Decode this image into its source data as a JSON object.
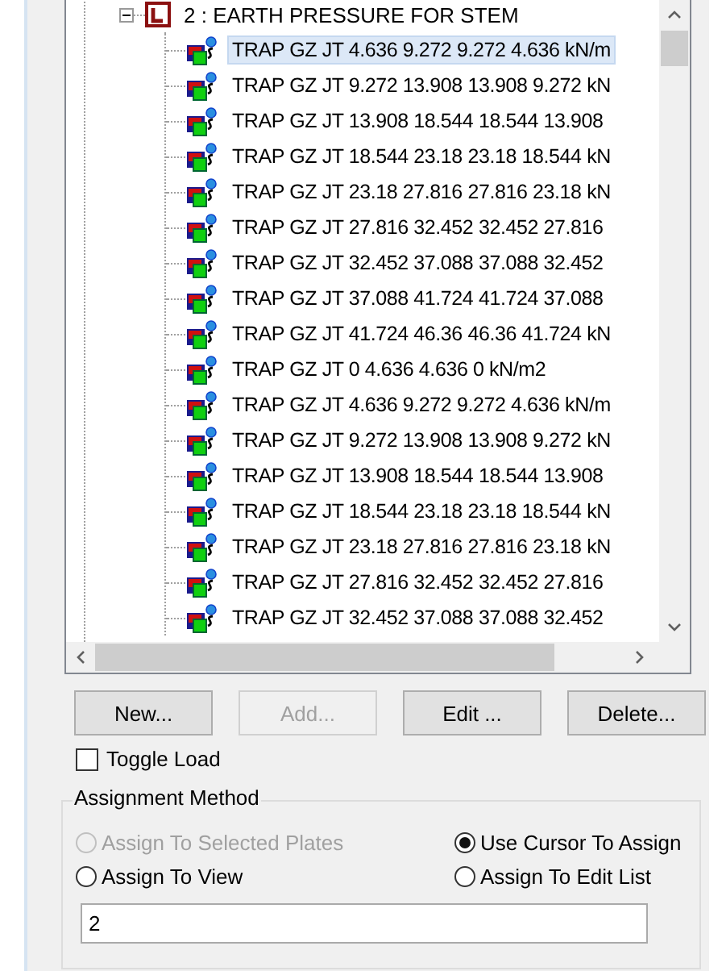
{
  "tree": {
    "group": {
      "label": "2 : EARTH PRESSURE FOR STEM",
      "expanded": true
    },
    "items": [
      {
        "label": "TRAP GZ JT 4.636 9.272 9.272 4.636  kN/m",
        "selected": true
      },
      {
        "label": "TRAP GZ JT 9.272 13.908 13.908 9.272  kN",
        "selected": false
      },
      {
        "label": "TRAP GZ JT 13.908 18.544 18.544 13.908",
        "selected": false
      },
      {
        "label": "TRAP GZ JT 18.544 23.18 23.18 18.544  kN",
        "selected": false
      },
      {
        "label": "TRAP GZ JT 23.18 27.816 27.816 23.18  kN",
        "selected": false
      },
      {
        "label": "TRAP GZ JT 27.816 32.452 32.452 27.816",
        "selected": false
      },
      {
        "label": "TRAP GZ JT 32.452 37.088 37.088 32.452",
        "selected": false
      },
      {
        "label": "TRAP GZ JT 37.088 41.724 41.724 37.088",
        "selected": false
      },
      {
        "label": "TRAP GZ JT 41.724 46.36 46.36 41.724  kN",
        "selected": false
      },
      {
        "label": "TRAP GZ JT 0 4.636 4.636 0  kN/m2",
        "selected": false
      },
      {
        "label": "TRAP GZ JT 4.636 9.272 9.272 4.636  kN/m",
        "selected": false
      },
      {
        "label": "TRAP GZ JT 9.272 13.908 13.908 9.272  kN",
        "selected": false
      },
      {
        "label": "TRAP GZ JT 13.908 18.544 18.544 13.908",
        "selected": false
      },
      {
        "label": "TRAP GZ JT 18.544 23.18 23.18 18.544  kN",
        "selected": false
      },
      {
        "label": "TRAP GZ JT 23.18 27.816 27.816 23.18  kN",
        "selected": false
      },
      {
        "label": "TRAP GZ JT 27.816 32.452 32.452 27.816",
        "selected": false
      },
      {
        "label": "TRAP GZ JT 32.452 37.088 37.088 32.452",
        "selected": false
      }
    ]
  },
  "buttons": [
    {
      "label": "New...",
      "disabled": false
    },
    {
      "label": "Add...",
      "disabled": true
    },
    {
      "label": "Edit ...",
      "disabled": false
    },
    {
      "label": "Delete...",
      "disabled": false
    }
  ],
  "toggle_load": {
    "label": "Toggle Load",
    "checked": false
  },
  "assignment_method": {
    "title": "Assignment Method",
    "options": [
      {
        "label": "Assign To Selected Plates",
        "selected": false,
        "disabled": true
      },
      {
        "label": "Use Cursor To Assign",
        "selected": true,
        "disabled": false
      },
      {
        "label": "Assign To View",
        "selected": false,
        "disabled": false
      },
      {
        "label": "Assign To Edit List",
        "selected": false,
        "disabled": false
      }
    ]
  },
  "field": {
    "value": "2"
  }
}
